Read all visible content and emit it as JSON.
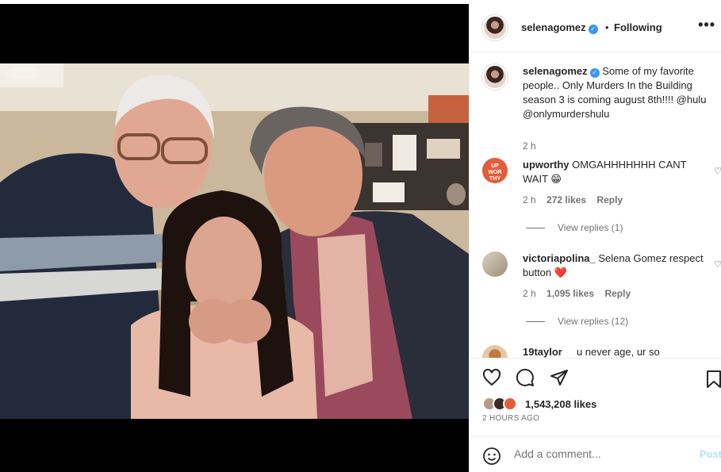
{
  "post": {
    "username": "selenagomez",
    "follow_status": "Following",
    "more_icon": "more-horizontal-icon",
    "separator": "•"
  },
  "caption": {
    "username": "selenagomez",
    "text": "Some of my favorite people.. Only Murders In the Building season 3 is coming august 8th!!!! @hulu @onlymurdershulu",
    "time": "2 h"
  },
  "comments": [
    {
      "username": "upworthy",
      "text": "OMGAHHHHHHH CANT WAIT 😁",
      "time": "2 h",
      "likes": "272 likes",
      "reply": "Reply",
      "view_replies": "View replies (1)",
      "avatar_label": "UP WOR THY"
    },
    {
      "username": "victoriapolina_",
      "text": "Selena Gomez respect button ❤️",
      "time": "2 h",
      "likes": "1,095 likes",
      "reply": "Reply",
      "view_replies": "View replies (12)"
    },
    {
      "username": "19taylor",
      "text": "u never age, ur so"
    }
  ],
  "actions": {
    "likes": "1,543,208 likes",
    "time_ago": "2 HOURS AGO"
  },
  "add_comment": {
    "placeholder": "Add a comment...",
    "post_label": "Post"
  },
  "colors": {
    "accent": "#0095f6",
    "verified": "#3897f0",
    "muted": "#737373"
  }
}
